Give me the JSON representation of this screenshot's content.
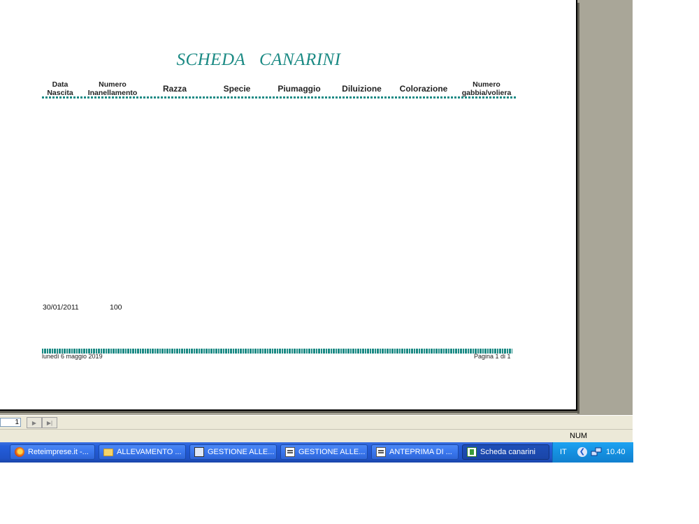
{
  "report": {
    "title": "SCHEDA   CANARINI",
    "columns": [
      {
        "line1": "Data",
        "line2": "Nascita"
      },
      {
        "line1": "Numero",
        "line2": "Inanellamento"
      },
      {
        "line1": "Razza"
      },
      {
        "line1": "Specie"
      },
      {
        "line1": "Piumaggio"
      },
      {
        "line1": "Diluizione"
      },
      {
        "line1": "Colorazione"
      },
      {
        "line1": "Numero",
        "line2": "gabbia/voliera"
      }
    ],
    "rows": [
      {
        "data_nascita": "30/01/2011",
        "numero_inanellamento": "100"
      }
    ],
    "footer_date": "lunedì 6 maggio 2019",
    "footer_page": "Pagina 1 di 1"
  },
  "navigation": {
    "page_value": "1",
    "next_icon": "next-page-icon",
    "last_icon": "last-page-icon"
  },
  "status": {
    "num_indicator": "NUM"
  },
  "taskbar": {
    "buttons": [
      {
        "label": "Reteimprese.it -...",
        "icon": "firefox-icon"
      },
      {
        "label": "ALLEVAMENTO ...",
        "icon": "folder-icon"
      },
      {
        "label": "GESTIONE ALLE...",
        "icon": "multi-window-icon"
      },
      {
        "label": "GESTIONE ALLE...",
        "icon": "form-icon"
      },
      {
        "label": "ANTEPRIMA DI ...",
        "icon": "form-icon"
      },
      {
        "label": "Scheda canarini",
        "icon": "report-icon",
        "active": true
      }
    ],
    "tray": {
      "language": "IT",
      "clock": "10.40"
    }
  }
}
